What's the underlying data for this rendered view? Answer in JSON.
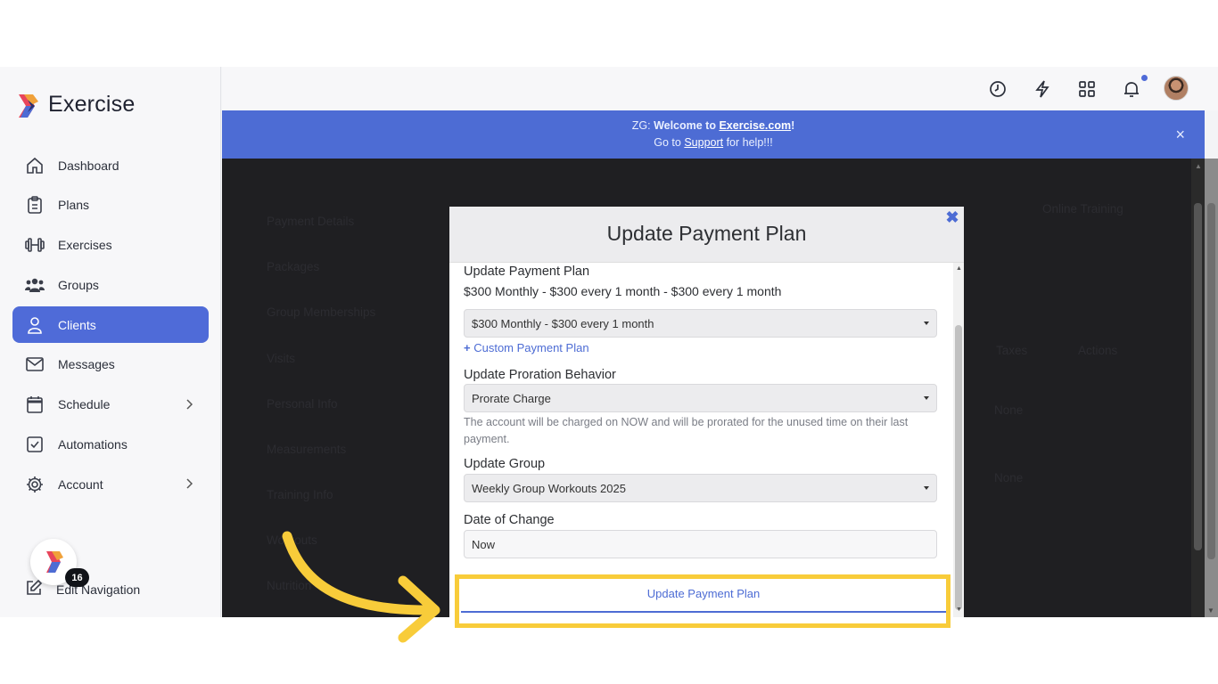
{
  "brand": {
    "name": "Exercise"
  },
  "sidebar": {
    "items": [
      {
        "label": "Dashboard",
        "icon": "home-icon"
      },
      {
        "label": "Plans",
        "icon": "clipboard-icon"
      },
      {
        "label": "Exercises",
        "icon": "dumbbell-icon"
      },
      {
        "label": "Groups",
        "icon": "users-icon"
      },
      {
        "label": "Clients",
        "icon": "user-icon",
        "active": true
      },
      {
        "label": "Messages",
        "icon": "mail-icon"
      },
      {
        "label": "Schedule",
        "icon": "calendar-icon",
        "has_submenu": true
      },
      {
        "label": "Automations",
        "icon": "checkbox-icon"
      },
      {
        "label": "Account",
        "icon": "gear-icon",
        "has_submenu": true
      }
    ],
    "edit_navigation": "Edit Navigation",
    "floating_badge": "16"
  },
  "topbar": {
    "icons": [
      "clock-icon",
      "lightning-icon",
      "apps-grid-icon",
      "bell-icon",
      "avatar"
    ]
  },
  "banner": {
    "prefix": "ZG: ",
    "welcome": "Welcome to ",
    "site": "Exercise.com",
    "bang": "!",
    "goto": "Go to ",
    "support": "Support",
    "suffix": " for help!!!",
    "close": "×"
  },
  "background": {
    "left_menu": [
      "Payment Details",
      "Packages",
      "Group Memberships",
      "Visits",
      "Personal Info",
      "Measurements",
      "Training Info",
      "Workouts",
      "Nutrition"
    ],
    "tabs": [
      "Online Training"
    ],
    "table_headers": [
      "Taxes",
      "Actions"
    ],
    "cells": [
      "None",
      "None"
    ]
  },
  "modal": {
    "title": "Update Payment Plan",
    "close": "✖",
    "current_label": "Update Payment Plan",
    "current_value": "$300 Monthly - $300 every 1 month - $300 every 1 month",
    "plan_select": "$300 Monthly - $300 every 1 month",
    "custom_link": "Custom Payment Plan",
    "proration_label": "Update Proration Behavior",
    "proration_select": "Prorate Charge",
    "proration_help": "The account will be charged on NOW and will be prorated for the unused time on their last payment.",
    "group_label": "Update Group",
    "group_select": "Weekly Group Workouts 2025",
    "date_label": "Date of Change",
    "date_value": "Now",
    "submit": "Update Payment Plan"
  },
  "colors": {
    "accent": "#4d6cd4",
    "highlight": "#f8cc3a",
    "arrow": "#f8cc3a"
  }
}
